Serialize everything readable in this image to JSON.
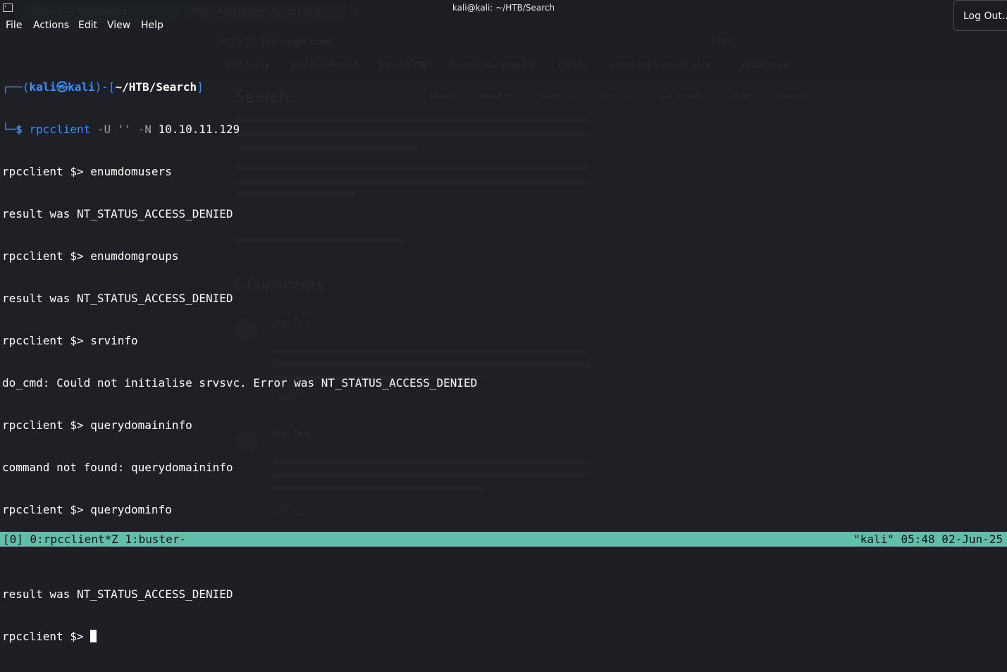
{
  "window": {
    "title": "kali@kali: ~/HTB/Search"
  },
  "menubar": {
    "items": [
      "File",
      "Actions",
      "Edit",
      "View",
      "Help"
    ]
  },
  "logout": {
    "label": "Log Out..."
  },
  "background_browser": {
    "tabs": [
      "Search — Tasking ltd",
      "403 - Forbidden: Access is d"
    ],
    "url": "10.10.11.129/single.html",
    "zoom": "110%",
    "bookmarks": [
      "Kali Linux",
      "Kali NetHunter",
      "Exploit-DB",
      "Google Hacking DB",
      "OffSec",
      "nmap krb5 enum user...",
      "WADComs"
    ],
    "site_name": "Search.",
    "nav": [
      "Home",
      "About Us",
      "Portfolio",
      "Services",
      "Testimonials",
      "Blog",
      "Contact"
    ],
    "comments_title": "6 Comments",
    "comment_author": "Jean Doe",
    "reply_label": "REPLY"
  },
  "prompt": {
    "corner_top": "┌──(",
    "user": "kali",
    "at": "㉿",
    "host": "kali",
    "mid": ")-[",
    "path": "~/HTB/Search",
    "end": "]",
    "corner_bottom": "└─",
    "dollar": "$ ",
    "cmd_name": "rpcclient",
    "cmd_args_gray": " -U '' -N ",
    "cmd_args_white": "10.10.11.129"
  },
  "output_lines": [
    "rpcclient $> enumdomusers",
    "result was NT_STATUS_ACCESS_DENIED",
    "rpcclient $> enumdomgroups",
    "result was NT_STATUS_ACCESS_DENIED",
    "rpcclient $> srvinfo",
    "do_cmd: Could not initialise srvsvc. Error was NT_STATUS_ACCESS_DENIED",
    "rpcclient $> querydomaininfo",
    "command not found: querydomaininfo",
    "rpcclient $> querydominfo",
    "",
    "result was NT_STATUS_ACCESS_DENIED"
  ],
  "current_prompt": "rpcclient $> ",
  "status_bar": {
    "left": "[0] 0:rpcclient*Z 1:buster-",
    "right": "\"kali\" 05:48 02-Jun-25"
  }
}
